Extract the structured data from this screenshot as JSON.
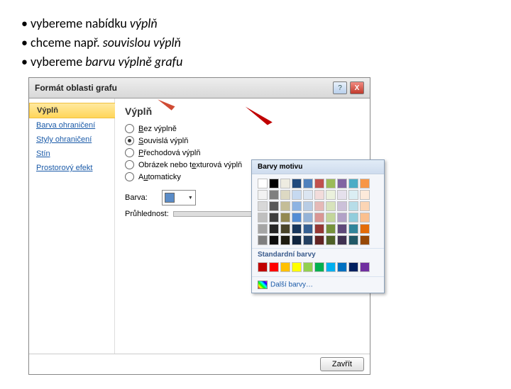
{
  "bullets": [
    {
      "pre": "vybereme nabídku ",
      "em": "výplň"
    },
    {
      "pre": "chceme např. ",
      "em": "souvislou výplň"
    },
    {
      "pre": "vybereme ",
      "em": "barvu výplně grafu"
    }
  ],
  "dialog": {
    "title": "Formát oblasti grafu",
    "help_icon": "?",
    "close_icon": "X"
  },
  "sidebar": {
    "items": [
      "Výplň",
      "Barva ohraničení",
      "Styly ohraničení",
      "Stín",
      "Prostorový efekt"
    ],
    "selected": 0
  },
  "panel": {
    "title": "Výplň",
    "options": [
      {
        "label_pre": "",
        "u": "B",
        "label_post": "ez výplně",
        "sel": false
      },
      {
        "label_pre": "",
        "u": "S",
        "label_post": "ouvislá výplň",
        "sel": true
      },
      {
        "label_pre": "",
        "u": "P",
        "label_post": "řechodová výplň",
        "sel": false
      },
      {
        "label_pre": "Obrázek nebo t",
        "u": "e",
        "label_post": "xturová výplň",
        "sel": false
      },
      {
        "label_pre": "A",
        "u": "u",
        "label_post": "tomaticky",
        "sel": false
      }
    ],
    "color_label": "Barva:",
    "transparency_label": "Průhlednost:"
  },
  "popup": {
    "title": "Barvy motivu",
    "sub": "Standardní barvy",
    "more": "Další barvy…"
  },
  "theme_colors": {
    "row0": [
      "#ffffff",
      "#000000",
      "#eeece1",
      "#1f497d",
      "#4f81bd",
      "#c0504d",
      "#9bbb59",
      "#8064a2",
      "#4bacc6",
      "#f79646"
    ],
    "row1": [
      "#f2f2f2",
      "#7f7f7f",
      "#ddd9c3",
      "#c6d9f0",
      "#dbe5f1",
      "#f2dcdb",
      "#ebf1dd",
      "#e5e0ec",
      "#dbeef3",
      "#fdeada"
    ],
    "row2": [
      "#d8d8d8",
      "#595959",
      "#c4bd97",
      "#8db3e2",
      "#b8cce4",
      "#e5b9b7",
      "#d7e3bc",
      "#ccc1d9",
      "#b7dde8",
      "#fbd5b5"
    ],
    "row3": [
      "#bfbfbf",
      "#3f3f3f",
      "#938953",
      "#548dd4",
      "#95b3d7",
      "#d99694",
      "#c3d69b",
      "#b2a2c7",
      "#92cddc",
      "#fac08f"
    ],
    "row4": [
      "#a5a5a5",
      "#262626",
      "#494429",
      "#17365d",
      "#366092",
      "#953734",
      "#76923c",
      "#5f497a",
      "#31859b",
      "#e36c09"
    ],
    "row5": [
      "#7f7f7f",
      "#0c0c0c",
      "#1d1b10",
      "#0f243e",
      "#244061",
      "#632423",
      "#4f6128",
      "#3f3151",
      "#205867",
      "#974806"
    ]
  },
  "standard_colors": [
    "#c00000",
    "#ff0000",
    "#ffc000",
    "#ffff00",
    "#92d050",
    "#00b050",
    "#00b0f0",
    "#0070c0",
    "#002060",
    "#7030a0"
  ],
  "footer": {
    "close": "Zavřít"
  }
}
